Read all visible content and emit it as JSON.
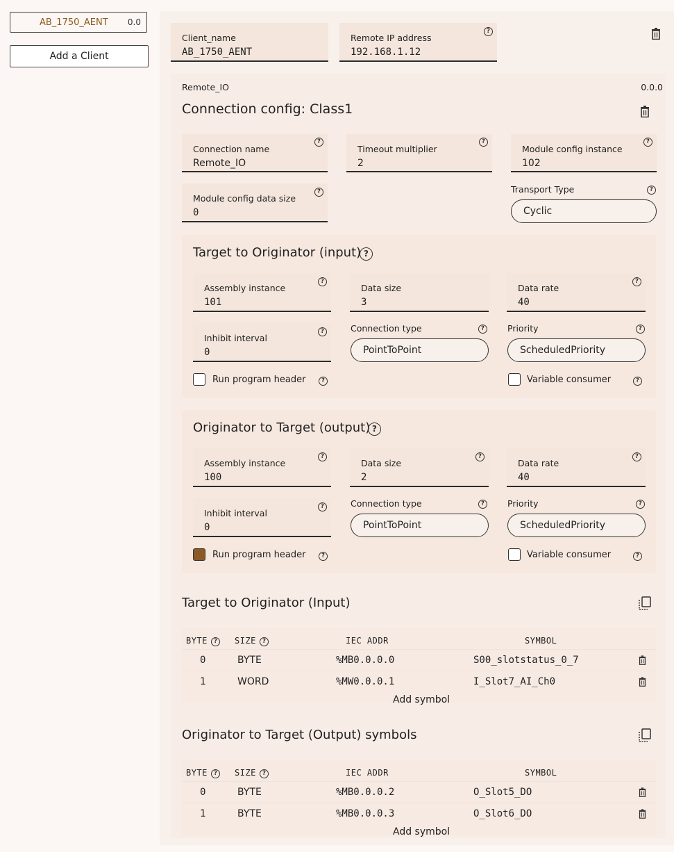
{
  "sidebar": {
    "client_name": "AB_1750_AENT",
    "client_version": "0.0",
    "add_client_label": "Add a Client"
  },
  "client": {
    "name_label": "Client_name",
    "name_value": "AB_1750_AENT",
    "ip_label": "Remote IP address",
    "ip_value": "192.168.1.12"
  },
  "connection": {
    "tag": "Remote_IO",
    "version": "0.0.0",
    "title": "Connection config: Class1",
    "fields": {
      "connection_name": {
        "label": "Connection name",
        "value": "Remote_IO"
      },
      "timeout_multiplier": {
        "label": "Timeout multiplier",
        "value": "2"
      },
      "module_config_instance": {
        "label": "Module config instance",
        "value": "102"
      },
      "module_config_data_size": {
        "label": "Module config data size",
        "value": "0"
      },
      "transport_type": {
        "label": "Transport Type",
        "value": "Cyclic"
      }
    }
  },
  "t2o": {
    "title": "Target to Originator (input)",
    "assembly_label": "Assembly instance",
    "assembly_value": "101",
    "data_size_label": "Data size",
    "data_size_value": "3",
    "data_rate_label": "Data rate",
    "data_rate_value": "40",
    "inhibit_label": "Inhibit interval",
    "inhibit_value": "0",
    "conn_type_label": "Connection type",
    "conn_type_value": "PointToPoint",
    "priority_label": "Priority",
    "priority_value": "ScheduledPriority",
    "run_program_label": "Run program header",
    "run_program_checked": false,
    "variable_consumer_label": "Variable consumer",
    "variable_consumer_checked": false
  },
  "o2t": {
    "title": "Originator to Target (output)",
    "assembly_label": "Assembly instance",
    "assembly_value": "100",
    "data_size_label": "Data size",
    "data_size_value": "2",
    "data_rate_label": "Data rate",
    "data_rate_value": "40",
    "inhibit_label": "Inhibit interval",
    "inhibit_value": "0",
    "conn_type_label": "Connection type",
    "conn_type_value": "PointToPoint",
    "priority_label": "Priority",
    "priority_value": "ScheduledPriority",
    "run_program_label": "Run program header",
    "run_program_checked": true,
    "variable_consumer_label": "Variable consumer",
    "variable_consumer_checked": false
  },
  "input_symbols": {
    "title": "Target to Originator (Input)",
    "columns": {
      "byte": "BYTE",
      "size": "SIZE",
      "iec": "IEC ADDR",
      "symbol": "SYMBOL"
    },
    "rows": [
      {
        "byte": "0",
        "size": "BYTE",
        "iec": "%MB0.0.0.0",
        "symbol": "S00_slotstatus_0_7"
      },
      {
        "byte": "1",
        "size": "WORD",
        "iec": "%MW0.0.0.1",
        "symbol": "I_Slot7_AI_Ch0"
      }
    ],
    "add_label": "Add symbol"
  },
  "output_symbols": {
    "title": "Originator to Target (Output) symbols",
    "columns": {
      "byte": "BYTE",
      "size": "SIZE",
      "iec": "IEC ADDR",
      "symbol": "SYMBOL"
    },
    "rows": [
      {
        "byte": "0",
        "size": "BYTE",
        "iec": "%MB0.0.0.2",
        "symbol": "O_Slot5_DO"
      },
      {
        "byte": "1",
        "size": "BYTE",
        "iec": "%MB0.0.0.3",
        "symbol": "O_Slot6_DO"
      }
    ],
    "add_label": "Add symbol"
  },
  "colors": {
    "accent": "#8b5a26",
    "field_bg": "#f4e6dc",
    "panel_bg": "#f8f0eb"
  }
}
